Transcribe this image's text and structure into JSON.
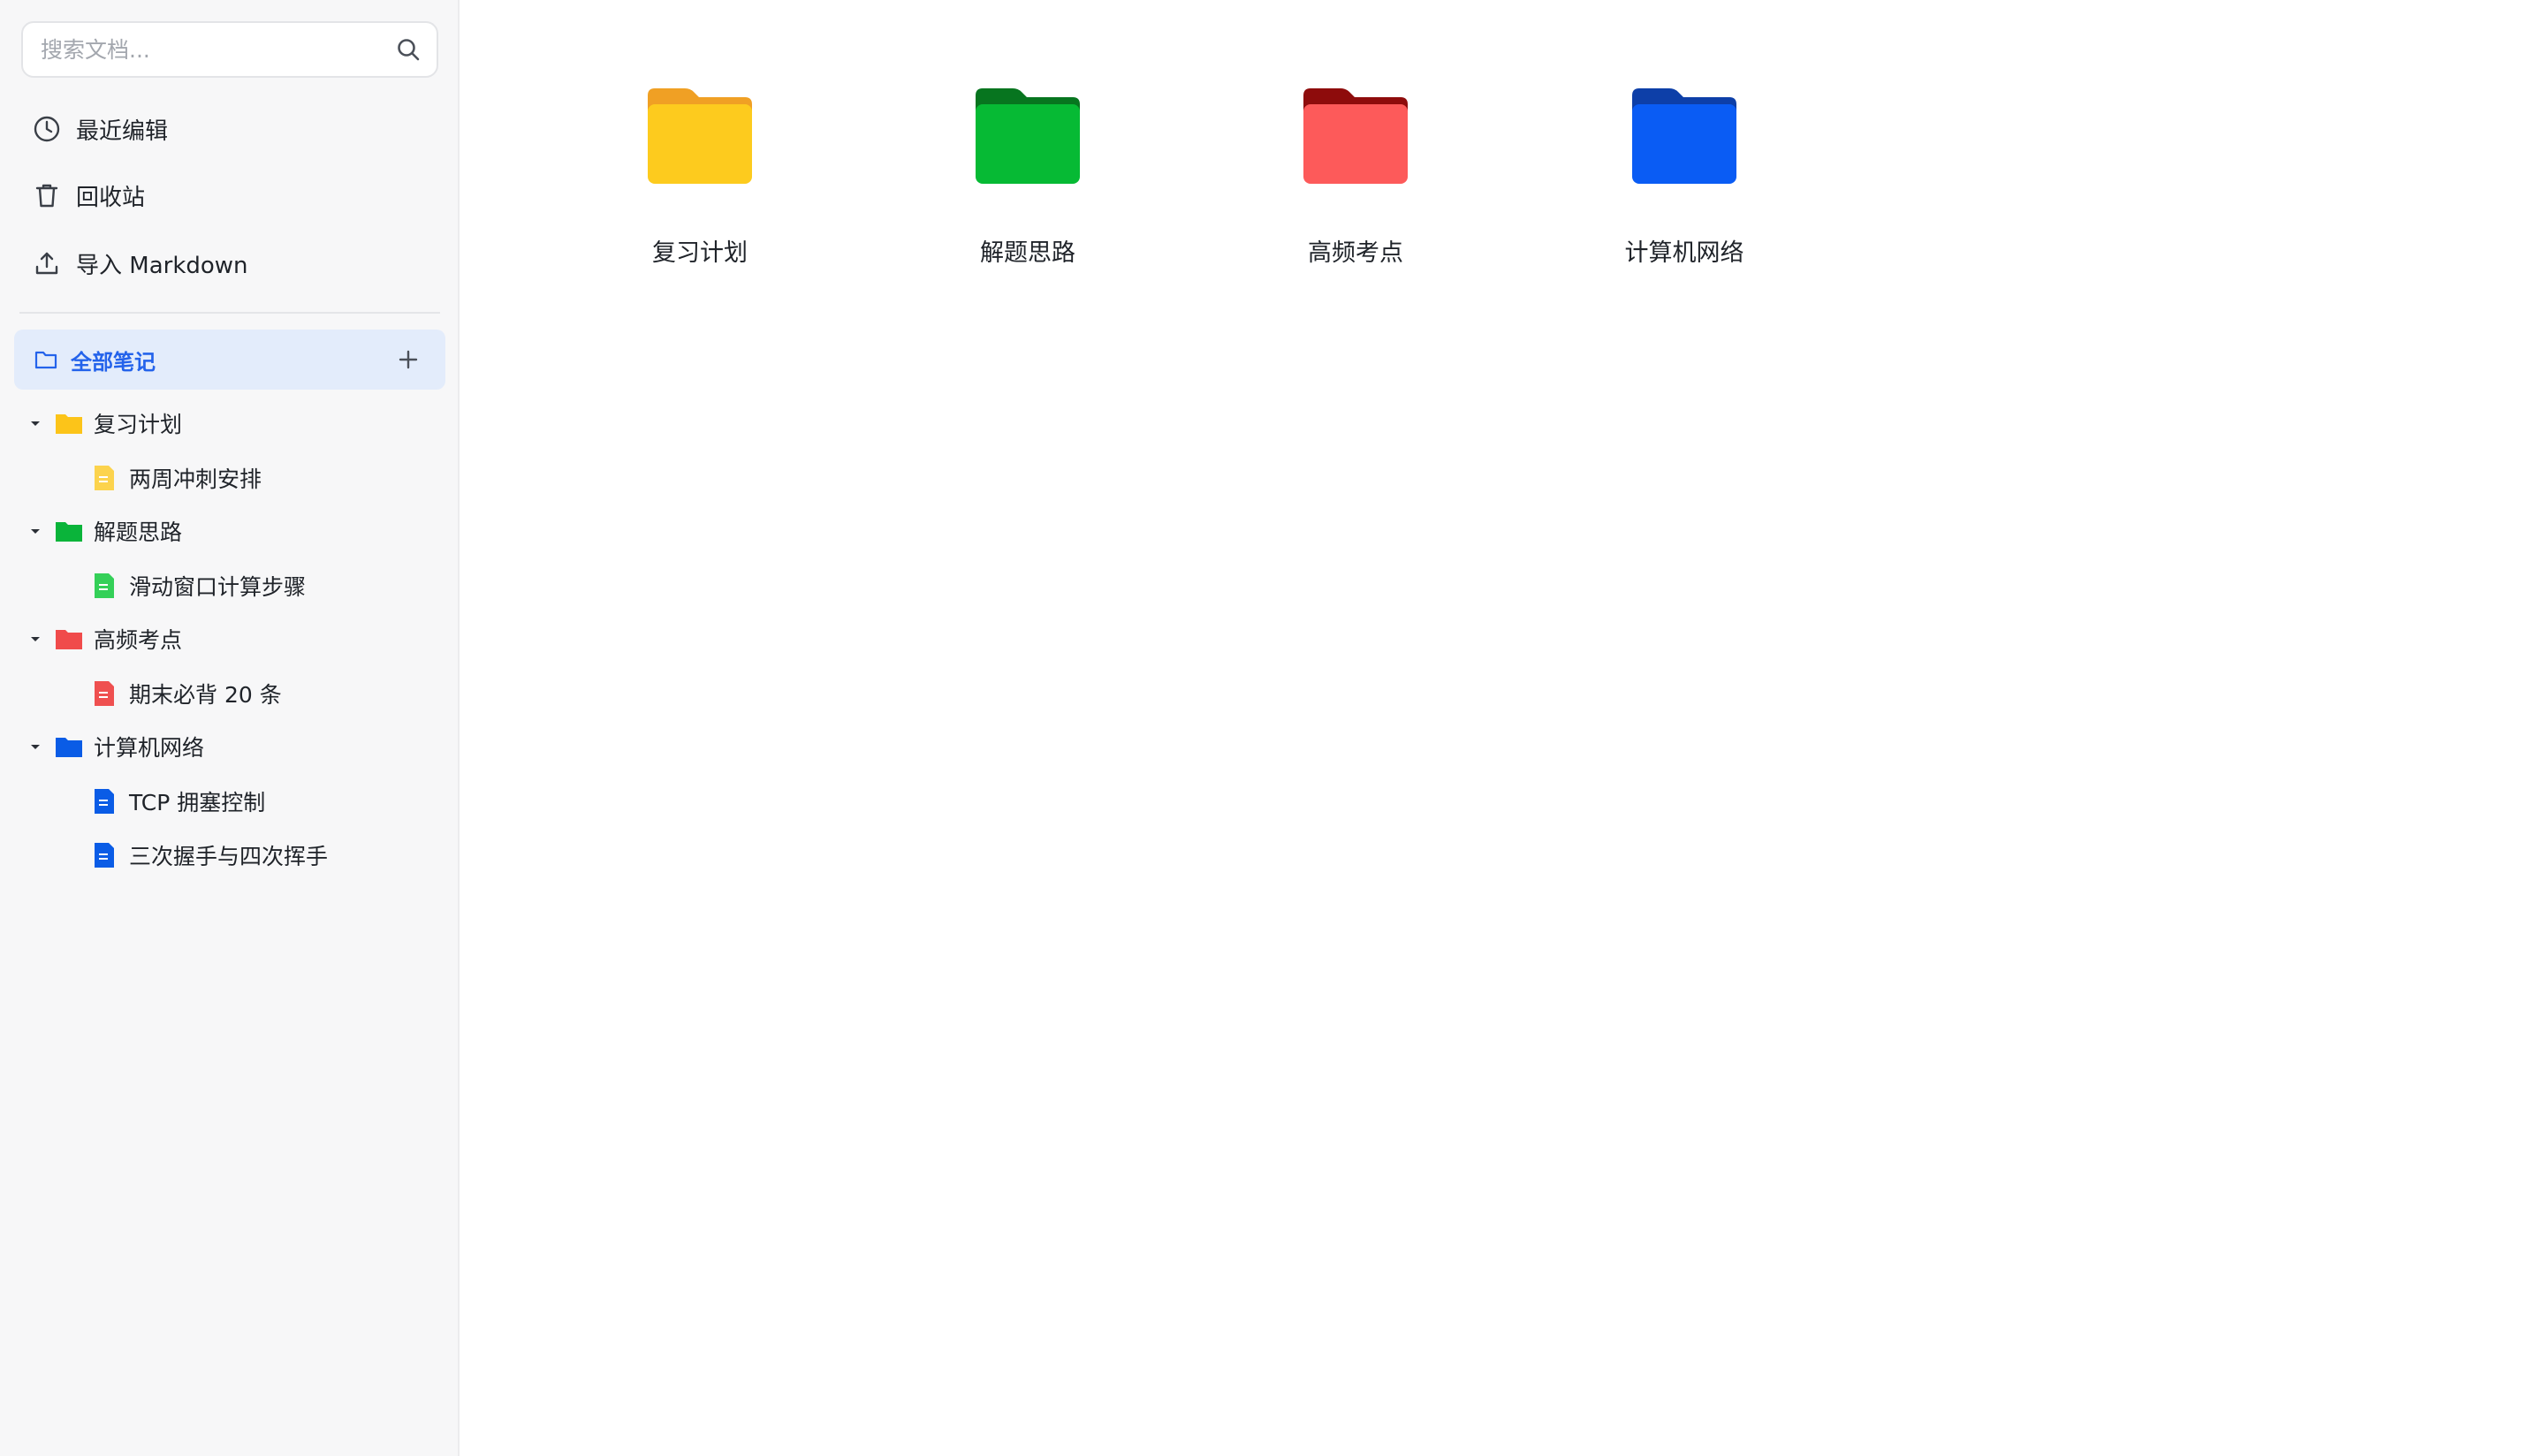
{
  "search": {
    "placeholder": "搜索文档..."
  },
  "nav": {
    "recent": "最近编辑",
    "trash": "回收站",
    "import": "导入 Markdown"
  },
  "all_notes": {
    "label": "全部笔记"
  },
  "tree": [
    {
      "name": "复习计划",
      "color": "#fcc419",
      "notes": [
        "两周冲刺安排"
      ]
    },
    {
      "name": "解题思路",
      "color": "#0ab43a",
      "notes": [
        "滑动窗口计算步骤"
      ]
    },
    {
      "name": "高频考点",
      "color": "#f04b4b",
      "notes": [
        "期末必背 20 条"
      ]
    },
    {
      "name": "计算机网络",
      "color": "#0a5ce6",
      "notes": [
        "TCP 拥塞控制",
        "三次握手与四次挥手"
      ]
    }
  ],
  "folders": [
    {
      "name": "复习计划",
      "color": "#fdcb1e",
      "tab_color": "#f0a024"
    },
    {
      "name": "解题思路",
      "color": "#06ba34",
      "tab_color": "#07751f"
    },
    {
      "name": "高频考点",
      "color": "#fd5a5a",
      "tab_color": "#8e0c0c"
    },
    {
      "name": "计算机网络",
      "color": "#0a5cf4",
      "tab_color": "#0d3fa8"
    }
  ],
  "icons": {
    "search": "search-icon",
    "recent": "clock-icon",
    "trash": "trash-icon",
    "import": "upload-icon",
    "all_notes": "folder-outline-icon",
    "add": "plus-icon",
    "caret": "caret-down-icon",
    "folder": "folder-icon",
    "note": "document-icon"
  },
  "colors": {
    "accent": "#2463eb",
    "selected_bg": "#e3ecfb",
    "sidebar_bg": "#f7f7f8"
  }
}
